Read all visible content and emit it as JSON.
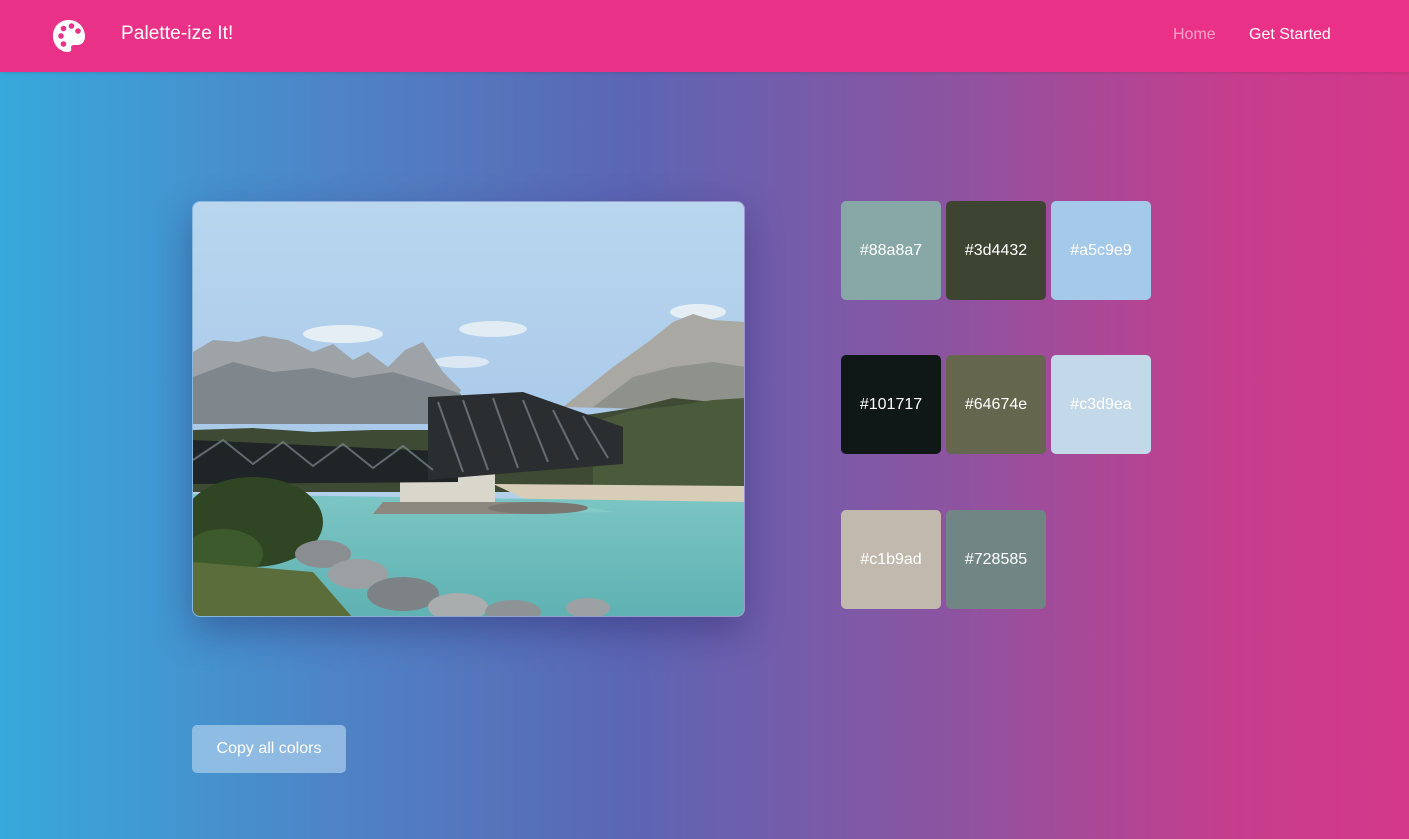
{
  "header": {
    "brand": "Palette-ize It!",
    "logo_icon": "palette-icon",
    "nav": [
      {
        "label": "Home",
        "active": false
      },
      {
        "label": "Get Started",
        "active": true
      }
    ],
    "background": "#e93287"
  },
  "main": {
    "photo_icon": "landscape-photo",
    "swatches": [
      {
        "hex": "#88a8a7"
      },
      {
        "hex": "#3d4432"
      },
      {
        "hex": "#a5c9e9"
      },
      {
        "hex": "#101717"
      },
      {
        "hex": "#64674e"
      },
      {
        "hex": "#c3d9ea"
      },
      {
        "hex": "#c1b9ad"
      },
      {
        "hex": "#728585"
      }
    ],
    "copy_button_label": "Copy all colors"
  }
}
